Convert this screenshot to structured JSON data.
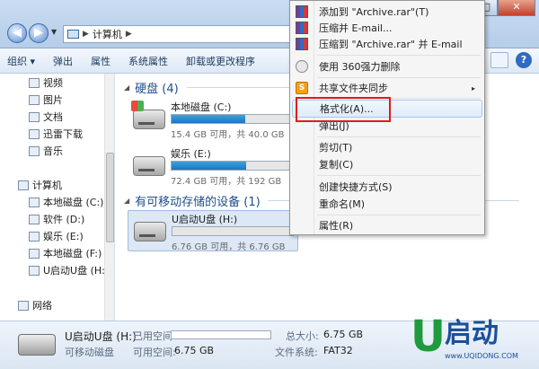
{
  "window": {
    "address": [
      "计算机"
    ],
    "controls": {
      "minimize": "–",
      "maximize": "□",
      "close": "✕"
    }
  },
  "toolbar": {
    "items": [
      "组织 ▾",
      "弹出",
      "属性",
      "系统属性",
      "卸载或更改程序"
    ],
    "help": "?"
  },
  "nav": {
    "favorites": [
      {
        "label": "视频",
        "icon": "video-folder-icon"
      },
      {
        "label": "图片",
        "icon": "pictures-folder-icon"
      },
      {
        "label": "文档",
        "icon": "documents-folder-icon"
      },
      {
        "label": "迅雷下载",
        "icon": "thunder-download-icon"
      },
      {
        "label": "音乐",
        "icon": "music-folder-icon"
      }
    ],
    "computer": "计算机",
    "drives": [
      "本地磁盘 (C:)",
      "软件 (D:)",
      "娱乐 (E:)",
      "本地磁盘 (F:)",
      "U启动U盘 (H:)"
    ],
    "network": "网络"
  },
  "content": {
    "hdd_group": "硬盘 (4)",
    "removable_group": "有可移动存储的设备 (1)",
    "drives": [
      {
        "name": "本地磁盘 (C:)",
        "info": "15.4 GB 可用，共 40.0 GB",
        "used_fraction": 0.615
      },
      {
        "name": "娱乐 (E:)",
        "info": "72.4 GB 可用，共 192 GB",
        "used_fraction": 0.623
      },
      {
        "name": "U启动U盘 (H:)",
        "info": "6.76 GB 可用，共 6.76 GB",
        "used_fraction": 0.0
      }
    ]
  },
  "details": {
    "name": "U启动U盘 (H:)",
    "type": "可移动磁盘",
    "used_label": "已用空间:",
    "free_label": "可用空间:",
    "free_value": "6.75 GB",
    "total_label": "总大小:",
    "total_value": "6.75 GB",
    "fs_label": "文件系统:",
    "fs_value": "FAT32",
    "used_fraction": 0.0
  },
  "context_menu": {
    "items": [
      {
        "label": "添加到 \"Archive.rar\"(T)",
        "icon": "winrar-icon"
      },
      {
        "label": "压缩并 E-mail...",
        "icon": "winrar-icon"
      },
      {
        "label": "压缩到 \"Archive.rar\" 并 E-mail",
        "icon": "winrar-icon"
      },
      {
        "label": "使用 360强力删除",
        "icon": "360-icon"
      },
      {
        "label": "共享文件夹同步",
        "icon": "share-sync-icon",
        "submenu": "▸"
      },
      {
        "label": "格式化(A)...",
        "highlighted": true
      },
      {
        "label": "弹出(J)"
      },
      {
        "label": "剪切(T)"
      },
      {
        "label": "复制(C)"
      },
      {
        "label": "创建快捷方式(S)"
      },
      {
        "label": "重命名(M)"
      },
      {
        "label": "属性(R)"
      }
    ]
  },
  "logo": {
    "mark": "U",
    "text": "启动",
    "url": "www.UQIDONG.COM"
  },
  "colors": {
    "highlight_box": "#e01b1b",
    "drive_fill": "#1d76c0",
    "group_title": "#1e4d8c"
  }
}
